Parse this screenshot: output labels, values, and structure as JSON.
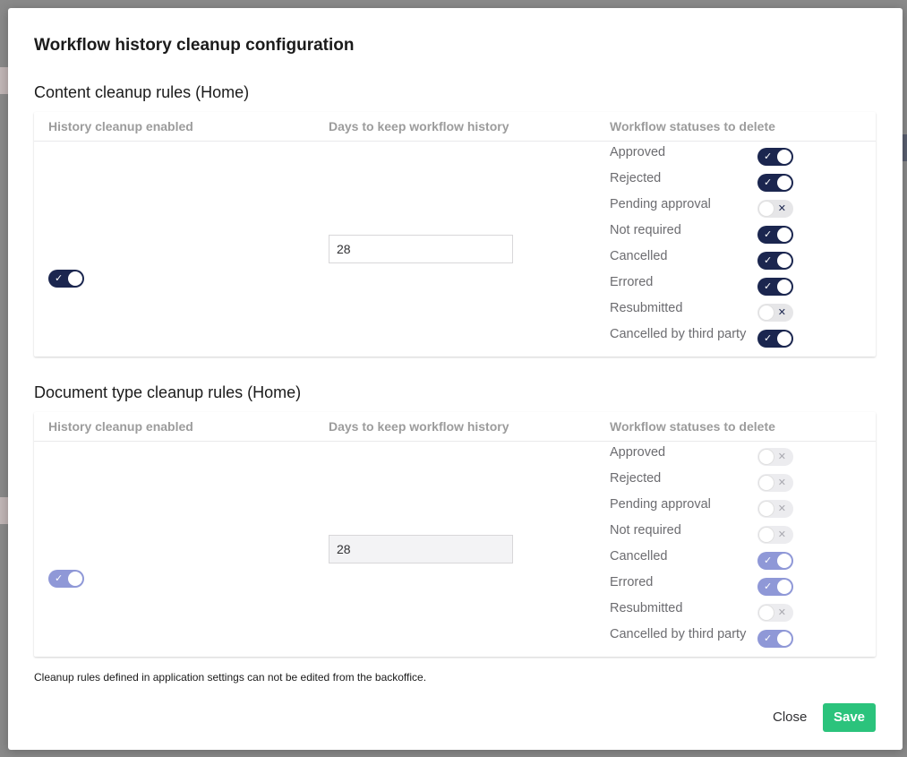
{
  "dialog": {
    "title": "Workflow history cleanup configuration",
    "footnote": "Cleanup rules defined in application settings can not be edited from the backoffice.",
    "close_label": "Close",
    "save_label": "Save"
  },
  "columns": {
    "enabled": "History cleanup enabled",
    "days": "Days to keep workflow history",
    "statuses": "Workflow statuses to delete"
  },
  "content_rules": {
    "title": "Content cleanup rules (Home)",
    "enabled": true,
    "days": "28",
    "statuses": [
      {
        "label": "Approved",
        "on": true
      },
      {
        "label": "Rejected",
        "on": true
      },
      {
        "label": "Pending approval",
        "on": false
      },
      {
        "label": "Not required",
        "on": true
      },
      {
        "label": "Cancelled",
        "on": true
      },
      {
        "label": "Errored",
        "on": true
      },
      {
        "label": "Resubmitted",
        "on": false
      },
      {
        "label": "Cancelled by third party",
        "on": true
      }
    ]
  },
  "doctype_rules": {
    "title": "Document type cleanup rules (Home)",
    "enabled": true,
    "days": "28",
    "statuses": [
      {
        "label": "Approved",
        "on": false
      },
      {
        "label": "Rejected",
        "on": false
      },
      {
        "label": "Pending approval",
        "on": false
      },
      {
        "label": "Not required",
        "on": false
      },
      {
        "label": "Cancelled",
        "on": true
      },
      {
        "label": "Errored",
        "on": true
      },
      {
        "label": "Resubmitted",
        "on": false
      },
      {
        "label": "Cancelled by third party",
        "on": true
      }
    ]
  },
  "colors": {
    "toggle_on": "#1b264f",
    "toggle_on_disabled": "#8f98d7",
    "save_button": "#2bc37c"
  }
}
